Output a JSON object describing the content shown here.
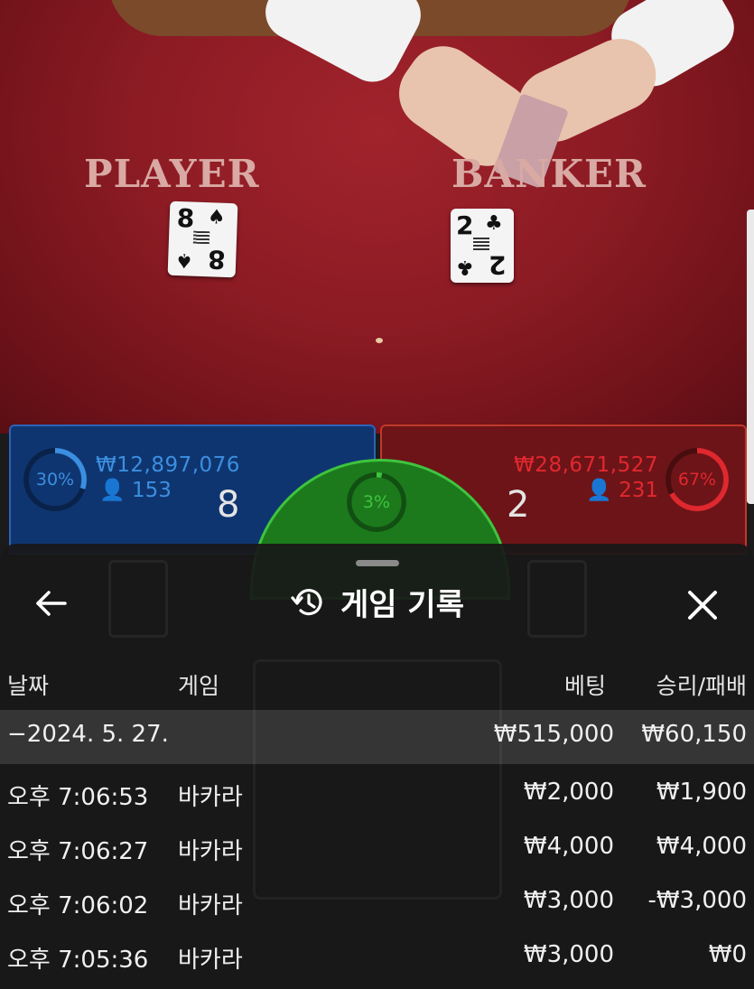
{
  "table": {
    "player_label": "PLAYER",
    "banker_label": "BANKER",
    "player_card": {
      "rank": "8",
      "suit": "♠"
    },
    "banker_card": {
      "rank": "2",
      "suit": "♣"
    }
  },
  "player": {
    "percent": "30%",
    "percent_value": 30,
    "amount": "₩12,897,076",
    "count": "153",
    "score": "8",
    "color": "#3b8fe0"
  },
  "banker": {
    "percent": "67%",
    "percent_value": 67,
    "amount": "₩28,671,527",
    "count": "231",
    "score": "2",
    "color": "#e0282f"
  },
  "tie": {
    "percent": "3%",
    "percent_value": 3,
    "color": "#3ec43e"
  },
  "history": {
    "title": "게임 기록",
    "icons": {
      "back": "arrow-left-icon",
      "history": "history-icon",
      "close": "close-icon"
    },
    "columns": {
      "date": "날짜",
      "game": "게임",
      "bet": "베팅",
      "result": "승리/패배"
    },
    "date_row": {
      "date": "−2024. 5. 27.",
      "bet": "₩515,000",
      "result": "₩60,150"
    },
    "rows": [
      {
        "time": "오후 7:06:53",
        "game": "바카라",
        "bet": "₩2,000",
        "result": "₩1,900"
      },
      {
        "time": "오후 7:06:27",
        "game": "바카라",
        "bet": "₩4,000",
        "result": "₩4,000"
      },
      {
        "time": "오후 7:06:02",
        "game": "바카라",
        "bet": "₩3,000",
        "result": "-₩3,000"
      },
      {
        "time": "오후 7:05:36",
        "game": "바카라",
        "bet": "₩3,000",
        "result": "₩0"
      }
    ]
  }
}
